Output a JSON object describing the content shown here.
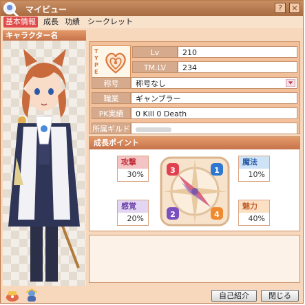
{
  "window": {
    "title": "マイビュー",
    "help_label": "?",
    "close_label": "×"
  },
  "tabs": [
    {
      "label": "基本情報"
    },
    {
      "label": "成長"
    },
    {
      "label": "功績"
    },
    {
      "label": "シークレット"
    }
  ],
  "profile": {
    "name_label": "キャラクター名",
    "type_label": "TYPE",
    "lv_label": "Lv",
    "lv_value": "210",
    "tmlv_label": "TM.LV",
    "tmlv_value": "234",
    "title_label": "称号",
    "title_value": "称号なし",
    "job_label": "職業",
    "job_value": "ギャンブラー",
    "pk_label": "PK実績",
    "pk_value": "0 Kill  0 Death",
    "guild_label": "所属ギルド"
  },
  "growth": {
    "header": "成長ポイント",
    "stats": [
      {
        "label": "攻撃",
        "value": "30%",
        "color": "#f4c4c4",
        "text_color": "#c0303a"
      },
      {
        "label": "魔法",
        "value": "10%",
        "color": "#cfe3f6",
        "text_color": "#2a5fa8"
      },
      {
        "label": "感覚",
        "value": "20%",
        "color": "#e2d6f2",
        "text_color": "#6b3fa8"
      },
      {
        "label": "魅力",
        "value": "40%",
        "color": "#fbe0c4",
        "text_color": "#c0602a"
      }
    ],
    "compass_numbers": [
      "3",
      "1",
      "2",
      "4"
    ]
  },
  "buttons": {
    "intro_label": "自己紹介",
    "close_label": "閉じる"
  },
  "colors": {
    "title_bar": "#b77a4f",
    "tab_active": "#e14a4a",
    "panel": "#f2c09b"
  },
  "icons": [
    "magnifier-avatar-icon",
    "heart-type-icon",
    "dropdown-arrow-icon",
    "compass-icon",
    "item-bag-icon",
    "character-icon"
  ]
}
